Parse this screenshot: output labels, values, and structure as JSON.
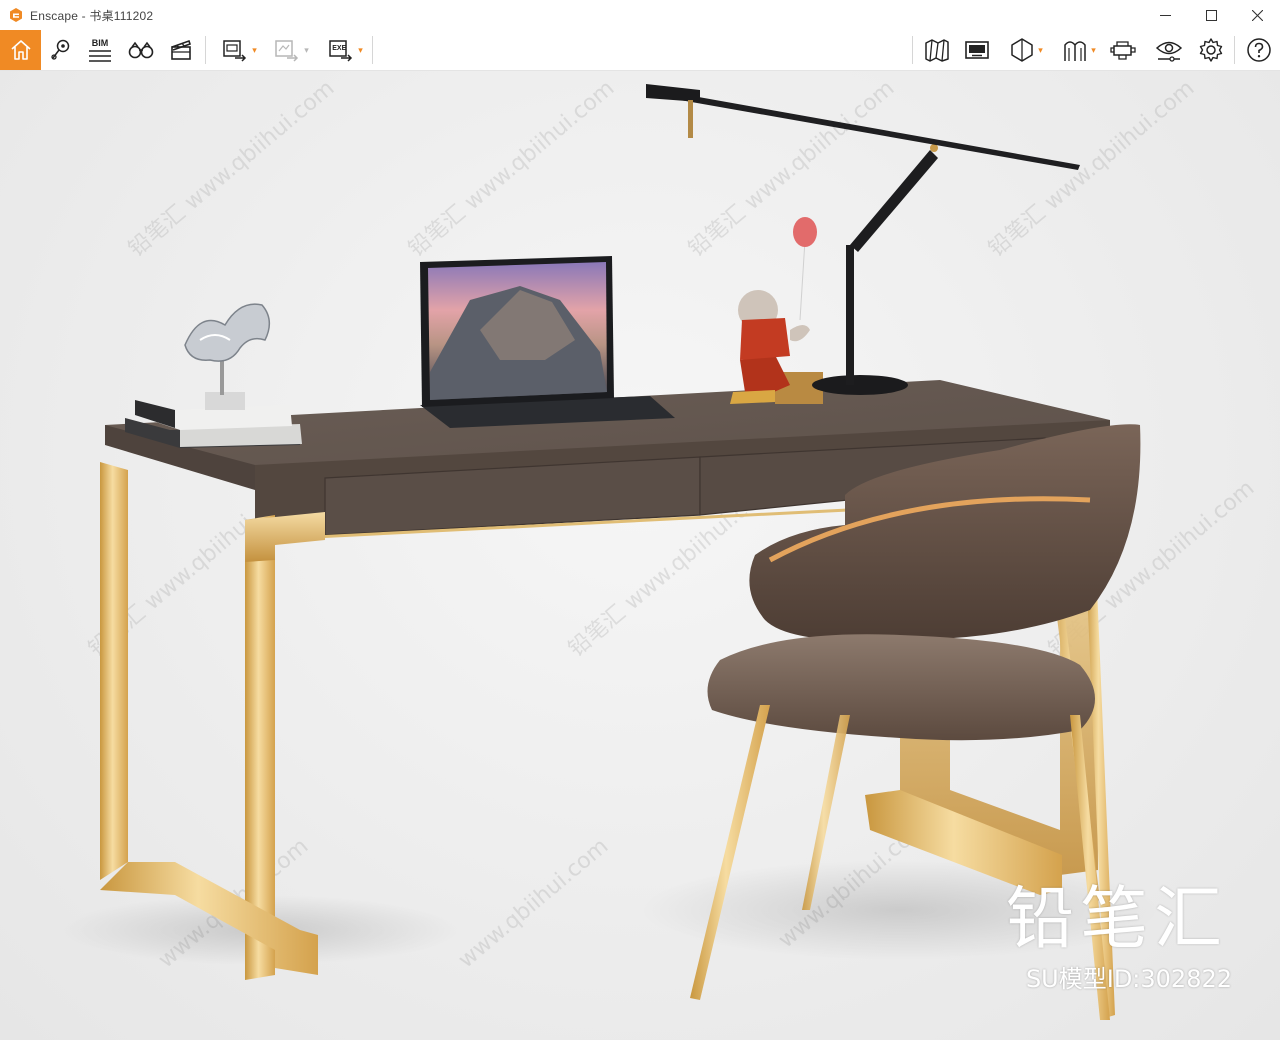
{
  "window": {
    "app_name": "Enscape",
    "separator": " - ",
    "document_title": "书桌111202",
    "accent_color": "#f08a24"
  },
  "toolbar": {
    "left": [
      {
        "icon": "home-icon"
      },
      {
        "icon": "location-pin-icon"
      },
      {
        "icon": "bim-icon",
        "label": "BIM"
      },
      {
        "icon": "binoculars-icon"
      },
      {
        "icon": "clapperboard-icon"
      },
      {
        "icon": "render-screenshot-icon"
      },
      {
        "icon": "export-panorama-icon"
      },
      {
        "icon": "export-exe-icon",
        "label": "EXE"
      }
    ],
    "right": [
      {
        "icon": "map-icon"
      },
      {
        "icon": "asset-library-icon"
      },
      {
        "icon": "section-view-icon"
      },
      {
        "icon": "views-icon"
      },
      {
        "icon": "vr-headset-icon"
      },
      {
        "icon": "visual-settings-icon"
      },
      {
        "icon": "settings-gear-icon"
      },
      {
        "icon": "help-icon"
      }
    ]
  },
  "viewport": {
    "watermark_text": "铅笔汇 www.qbiihui.com",
    "watermark_domain": "www.qbiihui.com",
    "brand_name": "铅笔汇",
    "model_id": "SU模型ID:302822",
    "desk_color": "#6b5f57",
    "frame_color": "#e8c277"
  }
}
